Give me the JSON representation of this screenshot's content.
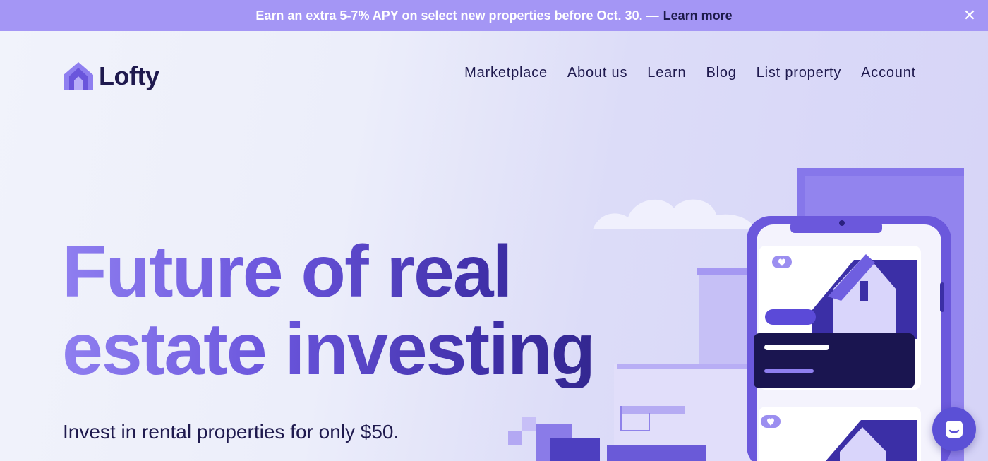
{
  "promo": {
    "text": "Earn an extra 5-7% APY on select new properties before Oct. 30. —",
    "link": "Learn more",
    "close": "✕"
  },
  "brand": {
    "name": "Lofty"
  },
  "nav": [
    "Marketplace",
    "About us",
    "Learn",
    "Blog",
    "List property",
    "Account"
  ],
  "hero": {
    "headline_line1": "Future of real",
    "headline_line2": "estate investing",
    "subtitle": "Invest in rental properties for only $50."
  },
  "colors": {
    "accent": "#6a55dc",
    "banner": "#a496f5",
    "dark": "#1f1a4e"
  }
}
